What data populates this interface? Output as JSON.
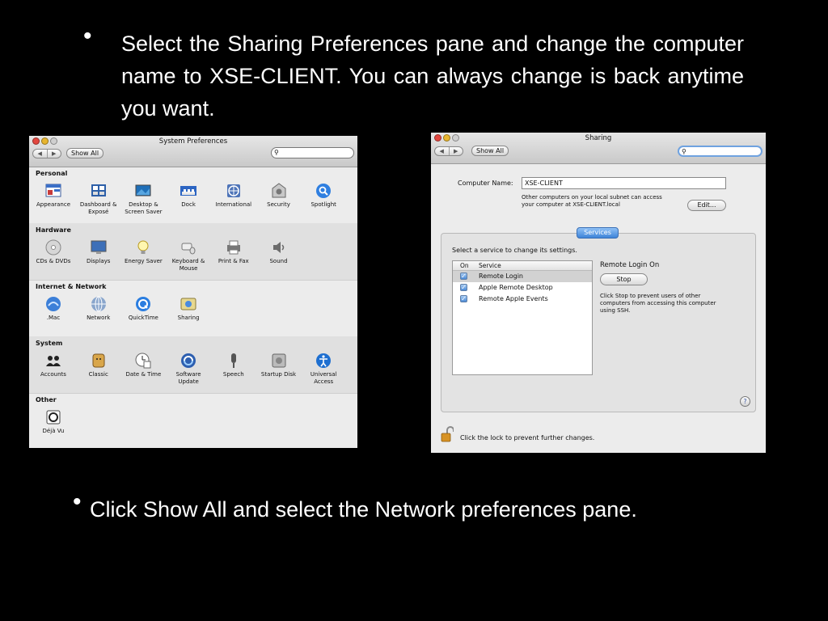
{
  "slide": {
    "bullet1": "Select the Sharing Preferences pane and change the computer name to XSE-CLIENT.  You can always change is back anytime you want.",
    "bullet2": "Click Show All and select the Network preferences pane."
  },
  "system_preferences": {
    "title": "System Preferences",
    "show_all": "Show All",
    "search_value": "",
    "sections": [
      {
        "title": "Personal",
        "panes": [
          {
            "label": "Appearance",
            "icon": "appearance-icon"
          },
          {
            "label": "Dashboard & Exposé",
            "icon": "dashboard-expose-icon"
          },
          {
            "label": "Desktop & Screen Saver",
            "icon": "desktop-screensaver-icon"
          },
          {
            "label": "Dock",
            "icon": "dock-icon"
          },
          {
            "label": "International",
            "icon": "international-icon"
          },
          {
            "label": "Security",
            "icon": "security-icon"
          },
          {
            "label": "Spotlight",
            "icon": "spotlight-icon"
          }
        ]
      },
      {
        "title": "Hardware",
        "panes": [
          {
            "label": "CDs & DVDs",
            "icon": "cds-dvds-icon"
          },
          {
            "label": "Displays",
            "icon": "displays-icon"
          },
          {
            "label": "Energy Saver",
            "icon": "energy-saver-icon"
          },
          {
            "label": "Keyboard & Mouse",
            "icon": "keyboard-mouse-icon"
          },
          {
            "label": "Print & Fax",
            "icon": "print-fax-icon"
          },
          {
            "label": "Sound",
            "icon": "sound-icon"
          }
        ]
      },
      {
        "title": "Internet & Network",
        "panes": [
          {
            "label": ".Mac",
            "icon": "dotmac-icon"
          },
          {
            "label": "Network",
            "icon": "network-icon"
          },
          {
            "label": "QuickTime",
            "icon": "quicktime-icon"
          },
          {
            "label": "Sharing",
            "icon": "sharing-icon"
          }
        ]
      },
      {
        "title": "System",
        "panes": [
          {
            "label": "Accounts",
            "icon": "accounts-icon"
          },
          {
            "label": "Classic",
            "icon": "classic-icon"
          },
          {
            "label": "Date & Time",
            "icon": "date-time-icon"
          },
          {
            "label": "Software Update",
            "icon": "software-update-icon"
          },
          {
            "label": "Speech",
            "icon": "speech-icon"
          },
          {
            "label": "Startup Disk",
            "icon": "startup-disk-icon"
          },
          {
            "label": "Universal Access",
            "icon": "universal-access-icon"
          }
        ]
      },
      {
        "title": "Other",
        "panes": [
          {
            "label": "Déjà Vu",
            "icon": "deja-vu-icon"
          }
        ]
      }
    ]
  },
  "sharing": {
    "title": "Sharing",
    "show_all": "Show All",
    "search_value": "",
    "computer_name_label": "Computer Name:",
    "computer_name_value": "XSE-CLIENT",
    "subnet_note_line1": "Other computers on your local subnet can access",
    "subnet_note_line2": "your computer at XSE-CLIENT.local",
    "edit_button": "Edit...",
    "tab_label": "Services",
    "select_service_text": "Select a service to change its settings.",
    "table_headers": {
      "on": "On",
      "service": "Service"
    },
    "services": [
      {
        "name": "Remote Login",
        "on": true,
        "selected": true
      },
      {
        "name": "Apple Remote Desktop",
        "on": true,
        "selected": false
      },
      {
        "name": "Remote Apple Events",
        "on": true,
        "selected": false
      }
    ],
    "status_title": "Remote Login On",
    "stop_button": "Stop",
    "description_line1": "Click Stop to prevent users of other",
    "description_line2": "computers from accessing this computer",
    "description_line3": "using SSH.",
    "help_glyph": "?",
    "lock_text": "Click the lock to prevent further changes."
  }
}
